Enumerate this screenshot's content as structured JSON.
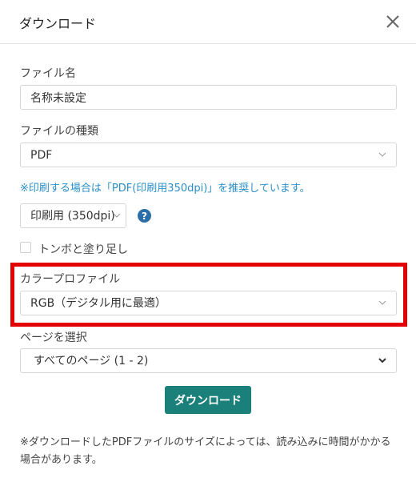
{
  "dialog": {
    "title": "ダウンロード"
  },
  "filename": {
    "label": "ファイル名",
    "value": "名称未設定"
  },
  "filetype": {
    "label": "ファイルの種類",
    "value": "PDF"
  },
  "print_note": "※印刷する場合は「PDF(印刷用350dpi)」を推奨しています。",
  "resolution": {
    "value": "印刷用 (350dpi)"
  },
  "trim_marks": {
    "label": "トンボと塗り足し",
    "checked": false
  },
  "color_profile": {
    "label": "カラープロファイル",
    "value": "RGB（デジタル用に最適）"
  },
  "pages": {
    "label": "ページを選択",
    "value": "すべてのページ (1 - 2)"
  },
  "download_button": "ダウンロード",
  "footnote": "※ダウンロードしたPDFファイルのサイズによっては、読み込みに時間がかかる場合があります。",
  "colors": {
    "accent": "#1b7f7a",
    "highlight": "#e30000",
    "note": "#2a8fc7",
    "help_icon": "#2a6fa8"
  }
}
